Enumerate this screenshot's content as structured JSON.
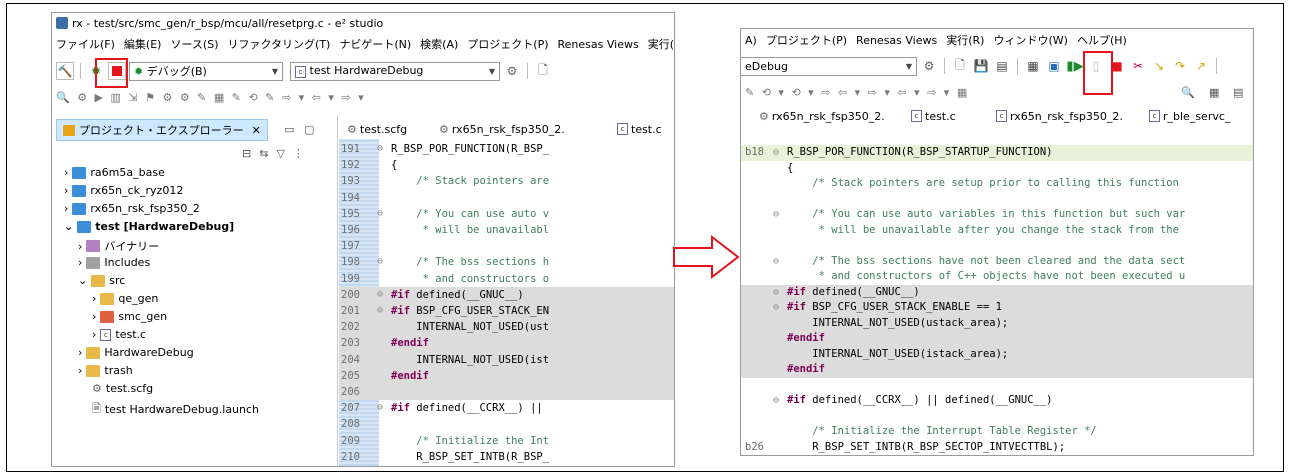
{
  "left": {
    "title": "rx - test/src/smc_gen/r_bsp/mcu/all/resetprg.c - e² studio",
    "menu": [
      "ファイル(F)",
      "編集(E)",
      "ソース(S)",
      "リファクタリング(T)",
      "ナビゲート(N)",
      "検索(A)",
      "プロジェクト(P)",
      "Renesas Views",
      "実行("
    ],
    "launch_mode": "デバッグ(B)",
    "launch_config": "test HardwareDebug",
    "explorer_title": "プロジェクト・エクスプローラー",
    "tree": [
      {
        "label": "ra6m5a_base"
      },
      {
        "label": "rx65n_ck_ryz012"
      },
      {
        "label": "rx65n_rsk_fsp350_2"
      },
      {
        "label": "test [HardwareDebug]"
      },
      {
        "label": "バイナリー"
      },
      {
        "label": "Includes"
      },
      {
        "label": "src"
      },
      {
        "label": "qe_gen"
      },
      {
        "label": "smc_gen"
      },
      {
        "label": "test.c"
      },
      {
        "label": "HardwareDebug"
      },
      {
        "label": "trash"
      },
      {
        "label": "test.scfg"
      },
      {
        "label": "test HardwareDebug.launch"
      }
    ],
    "editor_tabs": [
      "test.scfg",
      "rx65n_rsk_fsp350_2.",
      "test.c"
    ],
    "code": [
      {
        "n": "191",
        "t": "R_BSP_POR_FUNCTION(R_BSP_"
      },
      {
        "n": "192",
        "t": "{"
      },
      {
        "n": "193",
        "t": "    /* Stack pointers are"
      },
      {
        "n": "194",
        "t": ""
      },
      {
        "n": "195",
        "t": "    /* You can use auto v"
      },
      {
        "n": "196",
        "t": "     * will be unavailabl"
      },
      {
        "n": "197",
        "t": ""
      },
      {
        "n": "198",
        "t": "    /* The bss sections h"
      },
      {
        "n": "199",
        "t": "     * and constructors o"
      },
      {
        "n": "200",
        "t": "#if defined(__GNUC__)"
      },
      {
        "n": "201",
        "t": "#if BSP_CFG_USER_STACK_EN"
      },
      {
        "n": "202",
        "t": "    INTERNAL_NOT_USED(ust"
      },
      {
        "n": "203",
        "t": "#endif"
      },
      {
        "n": "204",
        "t": "    INTERNAL_NOT_USED(ist"
      },
      {
        "n": "205",
        "t": "#endif"
      },
      {
        "n": "206",
        "t": ""
      },
      {
        "n": "207",
        "t": "#if defined(__CCRX__) ||"
      },
      {
        "n": "208",
        "t": ""
      },
      {
        "n": "209",
        "t": "    /* Initialize the Int"
      },
      {
        "n": "210",
        "t": "    R_BSP_SET_INTB(R_BSP_"
      }
    ]
  },
  "right": {
    "menu": [
      "A)",
      "プロジェクト(P)",
      "Renesas Views",
      "実行(R)",
      "ウィンドウ(W)",
      "ヘルプ(H)"
    ],
    "launch_config": "eDebug",
    "editor_tabs": [
      "rx65n_rsk_fsp350_2.",
      "test.c",
      "rx65n_rsk_fsp350_2.",
      "r_ble_servc_"
    ],
    "code": [
      {
        "n": "b18",
        "t": "R_BSP_POR_FUNCTION(R_BSP_STARTUP_FUNCTION)"
      },
      {
        "n": "",
        "t": "{"
      },
      {
        "n": "",
        "t": "    /* Stack pointers are setup prior to calling this function"
      },
      {
        "n": "",
        "t": ""
      },
      {
        "n": "",
        "t": "    /* You can use auto variables in this function but such var"
      },
      {
        "n": "",
        "t": "     * will be unavailable after you change the stack from the"
      },
      {
        "n": "",
        "t": ""
      },
      {
        "n": "",
        "t": "    /* The bss sections have not been cleared and the data sect"
      },
      {
        "n": "",
        "t": "     * and constructors of C++ objects have not been executed u"
      },
      {
        "n": "",
        "t": "#if defined(__GNUC__)"
      },
      {
        "n": "",
        "t": "#if BSP_CFG_USER_STACK_ENABLE == 1"
      },
      {
        "n": "",
        "t": "    INTERNAL_NOT_USED(ustack_area);"
      },
      {
        "n": "",
        "t": "#endif"
      },
      {
        "n": "",
        "t": "    INTERNAL_NOT_USED(istack_area);"
      },
      {
        "n": "",
        "t": "#endif"
      },
      {
        "n": "",
        "t": ""
      },
      {
        "n": "",
        "t": "#if defined(__CCRX__) || defined(__GNUC__)"
      },
      {
        "n": "",
        "t": ""
      },
      {
        "n": "",
        "t": "    /* Initialize the Interrupt Table Register */"
      },
      {
        "n": "b26",
        "t": "    R_BSP_SET_INTB(R_BSP_SECTOP_INTVECTTBL);"
      }
    ]
  },
  "colors": {
    "highlight": "#e3141c",
    "arrow": "#e3141c",
    "ifdef_bg": "#dcdcdc",
    "selected": "#cde8ff"
  }
}
